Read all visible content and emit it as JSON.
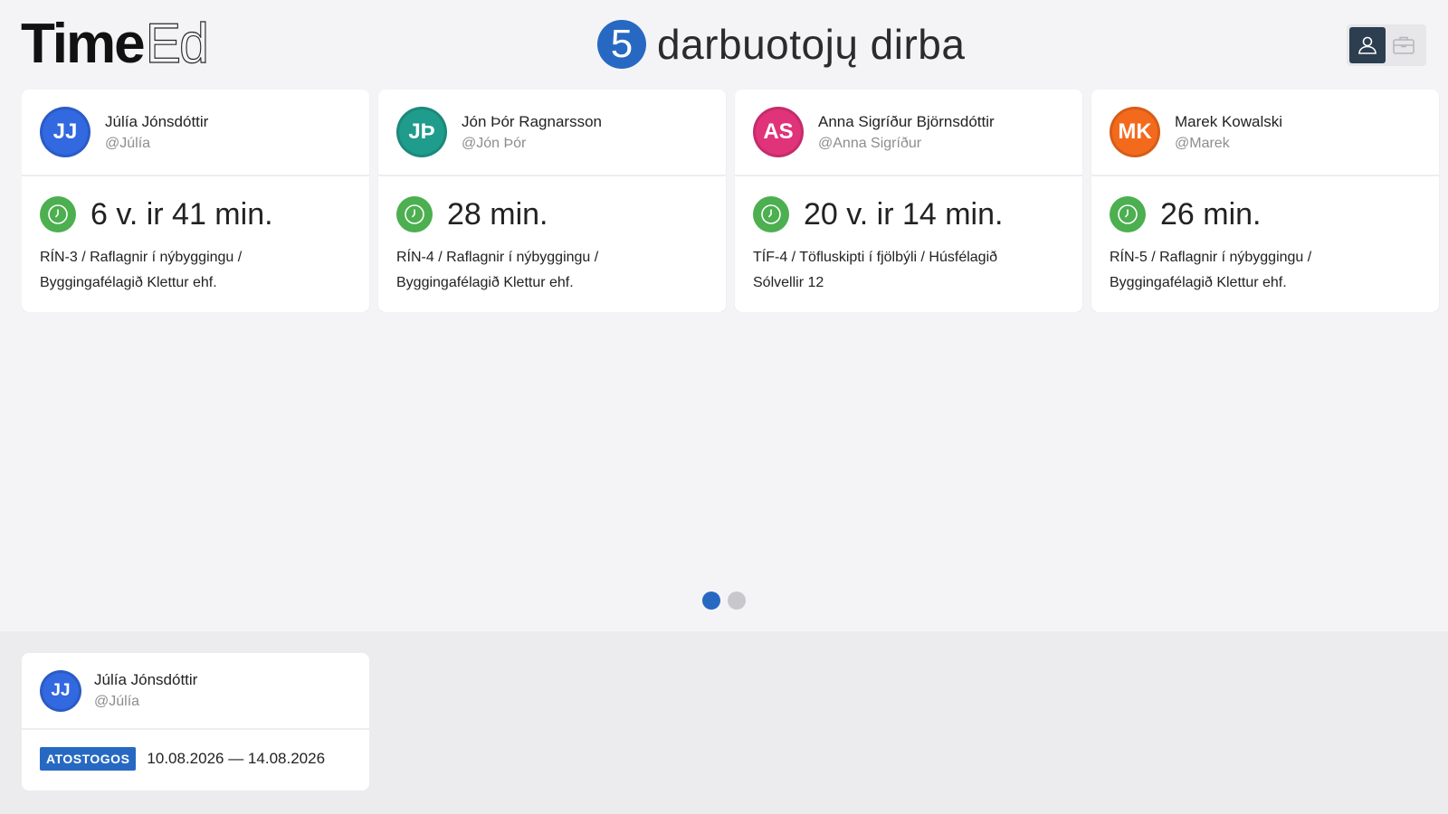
{
  "app": {
    "logo_bold": "Time",
    "logo_thin": "Ed",
    "working_count": "5",
    "working_label": "darbuotojų dirba"
  },
  "view_toggle": {
    "options": [
      {
        "icon": "person-icon",
        "active": true
      },
      {
        "icon": "briefcase-icon",
        "active": false
      }
    ]
  },
  "workers": [
    {
      "initials": "JJ",
      "color": "#3268e0",
      "name": "Júlía Jónsdóttir",
      "handle": "@Júlía",
      "duration": "6 v. ir 41 min.",
      "task_line1": "RÍN-3 / Raflagnir í nýbyggingu /",
      "task_line2": "Byggingafélagið Klettur ehf."
    },
    {
      "initials": "JÞ",
      "color": "#1f9c8c",
      "name": "Jón Þór Ragnarsson",
      "handle": "@Jón Þór",
      "duration": "28 min.",
      "task_line1": "RÍN-4 / Raflagnir í nýbyggingu /",
      "task_line2": "Byggingafélagið Klettur ehf."
    },
    {
      "initials": "AS",
      "color": "#e0337a",
      "name": "Anna Sigríður Björnsdóttir",
      "handle": "@Anna Sigríður",
      "duration": "20 v. ir 14 min.",
      "task_line1": "TÍF-4 / Töfluskipti í fjölbýli / Húsfélagið",
      "task_line2": "Sólvellir 12"
    },
    {
      "initials": "MK",
      "color": "#f46a1d",
      "name": "Marek Kowalski",
      "handle": "@Marek",
      "duration": "26 min.",
      "task_line1": "RÍN-5 / Raflagnir í nýbyggingu /",
      "task_line2": "Byggingafélagið Klettur ehf."
    }
  ],
  "pager": {
    "pages": 2,
    "current": 1
  },
  "leave": {
    "initials": "JJ",
    "color": "#3268e0",
    "name": "Júlía Jónsdóttir",
    "handle": "@Júlía",
    "badge": "ATOSTOGOS",
    "dates": "10.08.2026 — 14.08.2026"
  },
  "colors": {
    "accent": "#2769c2",
    "clock_green": "#4caf50",
    "toggle_active": "#2c3e50"
  }
}
